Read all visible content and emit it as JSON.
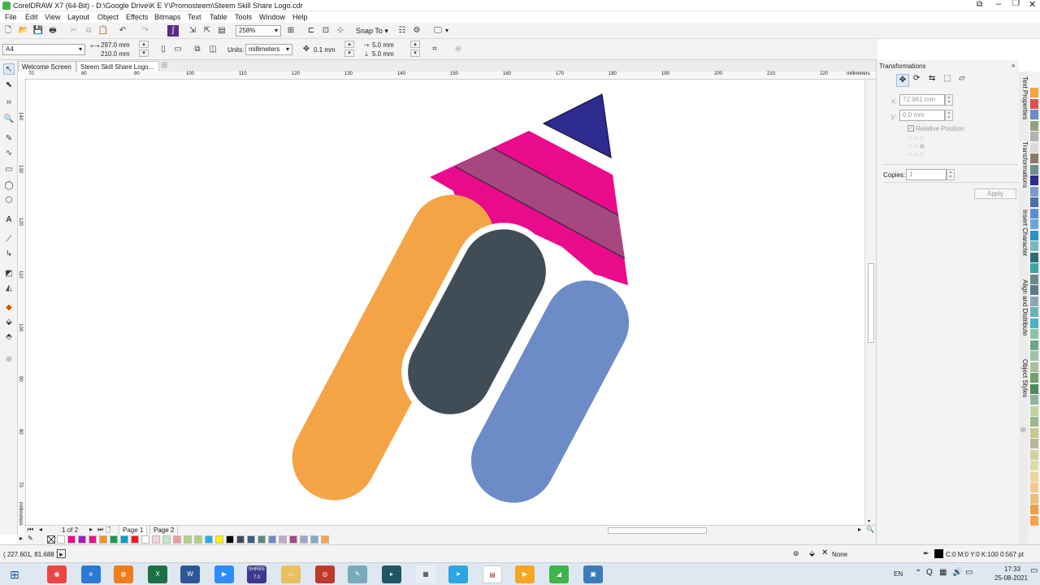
{
  "window": {
    "title": "CorelDRAW X7 (64-Bit) - D:\\Google Drive\\K E Y\\Promosteem\\Steem Skill Share Logo.cdr"
  },
  "menu": [
    "File",
    "Edit",
    "View",
    "Layout",
    "Object",
    "Effects",
    "Bitmaps",
    "Text",
    "Table",
    "Tools",
    "Window",
    "Help"
  ],
  "toolbar": {
    "zoom": "258%",
    "snap_label": "Snap To"
  },
  "propbar": {
    "page_size": "A4",
    "width": "297.0 mm",
    "height": "210.0 mm",
    "units_label": "Units:",
    "units": "millimeters",
    "nudge": "0.1 mm",
    "dup_x": "5.0 mm",
    "dup_y": "5.0 mm"
  },
  "tabs": [
    "Welcome Screen",
    "Steem Skill Share Logo..."
  ],
  "ruler": {
    "top": [
      "70",
      "80",
      "90",
      "100",
      "110",
      "120",
      "130",
      "140",
      "150",
      "160",
      "170",
      "180",
      "190",
      "200",
      "210",
      "220"
    ],
    "unit": "millimeters",
    "left": [
      "140",
      "130",
      "120",
      "110",
      "100",
      "90",
      "80",
      "70",
      "60"
    ],
    "left_unit": "millimeters"
  },
  "page_nav": {
    "count": "1 of 2",
    "pages": [
      "Page 1",
      "Page 2"
    ]
  },
  "status": {
    "coords": "( 227.601, 81.688 )",
    "fill_none": "None",
    "outline": "C:0 M:0 Y:0 K:100  0.567 pt"
  },
  "docker": {
    "title": "Transformations",
    "x_label": "x:",
    "x_value": "72.961 mm",
    "y_label": "y:",
    "y_value": "0.0 mm",
    "relative": "Relative Position",
    "copies_label": "Copies:",
    "copies_value": "1",
    "apply": "Apply",
    "side_tabs": [
      "Text Properties",
      "Transformations",
      "Insert Character",
      "Align and Distribute",
      "Object Styles"
    ]
  },
  "taskbar": {
    "lang": "EN",
    "time": "17:33",
    "date": "25-08-2021",
    "shree": "SHREE 7.0"
  },
  "colors": {
    "pencil_tip": "#2e2b8e",
    "pencil_body": "#ea0a8c",
    "pencil_band": "#a6477f",
    "orange": "#f5a445",
    "slate": "#404c56",
    "blue": "#6d8bc7",
    "palette": [
      "#ffffff",
      "#e90e8b",
      "#a61ac8",
      "#e8128c",
      "#f7941d",
      "#1a9b4a",
      "#00a0c6",
      "#ed1c24",
      "#ffffff",
      "#f2d2e0",
      "#c8e6c9",
      "#ef9a9a",
      "#aed581",
      "#b0d47c",
      "#29abe2",
      "#fff200",
      "#000000",
      "#404c56",
      "#3d5a80",
      "#5c8a7b",
      "#6d8bc7",
      "#c0a6d0",
      "#a6477f",
      "#9aa7c7",
      "#8aa8c8",
      "#f5a445"
    ],
    "right_palette": [
      "#f5a445",
      "#e05050",
      "#6d8bc7",
      "#8fa37a",
      "#b3b3b3",
      "#d9d9d9",
      "#8b7b6b",
      "#6e8f8b",
      "#2e2b8e",
      "#7b9bc7",
      "#4f6fa8",
      "#5f8dd2",
      "#6aa5d9",
      "#2b91c9",
      "#7ab5c0",
      "#2e6e7b",
      "#3fa3a3",
      "#6a8a8a",
      "#5a7a8a",
      "#89a6b4",
      "#67b3b6",
      "#4fb1c4",
      "#8ec2a4",
      "#6ea68a",
      "#9fc1a8",
      "#aac197",
      "#739f70",
      "#4d8b5a",
      "#8fb49e",
      "#c2d2a6",
      "#9bb58d",
      "#c6c78f",
      "#b7b797",
      "#d3cfa0",
      "#dddca8",
      "#e7d69e",
      "#f1c98c",
      "#eac17a",
      "#ee9f4e",
      "#f5a445"
    ]
  }
}
